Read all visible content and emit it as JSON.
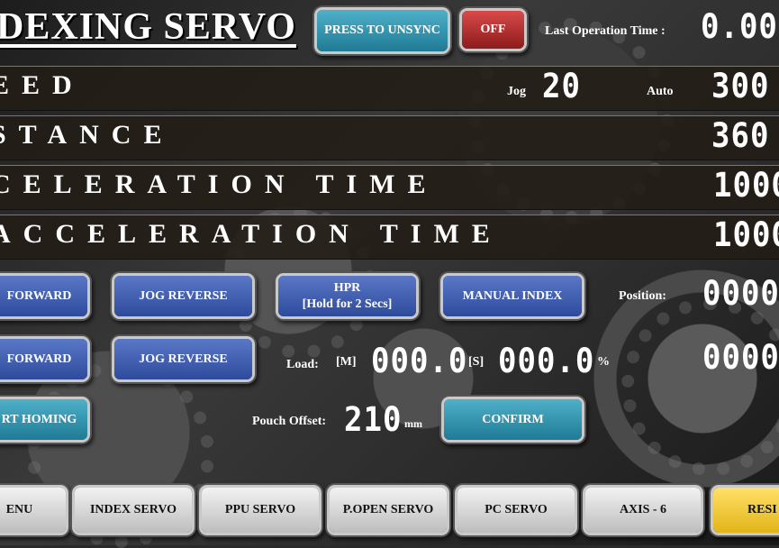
{
  "header": {
    "title": "DEXING SERVO",
    "sync_button": "PRESS TO UNSYNC",
    "off_button": "OFF",
    "last_op_label": "Last Operation Time :",
    "last_op_value": "0.00"
  },
  "rows": {
    "speed": {
      "label": "EED",
      "jog_label": "Jog",
      "jog_value": "20",
      "auto_label": "Auto",
      "auto_value": "300"
    },
    "distance": {
      "label": "STANCE",
      "value": "360"
    },
    "acceleration": {
      "label": "CELERATION TIME",
      "value": "1000"
    },
    "deceleration": {
      "label": "ACCELERATION TIME",
      "value": "1000"
    }
  },
  "controls": {
    "row1": {
      "forward": "FORWARD",
      "jog_reverse": "JOG REVERSE",
      "hpr": "HPR\n[Hold for 2 Secs]",
      "manual_index": "MANUAL INDEX",
      "position_label": "Position:",
      "position_value": "0000"
    },
    "row2": {
      "forward": "FORWARD",
      "jog_reverse": "JOG REVERSE",
      "load_label": "Load:",
      "m_label": "[M]",
      "m_value": "000.0",
      "s_label": "[S]",
      "s_value": "000.0",
      "percent": "%",
      "value": "0000"
    },
    "row3": {
      "homing": "RT HOMING",
      "pouch_label": "Pouch Offset:",
      "pouch_value": "210",
      "pouch_unit": "mm",
      "confirm": "CONFIRM"
    }
  },
  "nav": [
    "ENU",
    "INDEX SERVO",
    "PPU SERVO",
    "P.OPEN SERVO",
    "PC SERVO",
    "AXIS - 6",
    "RESI"
  ],
  "colors": {
    "blue": "#3a5bb0",
    "teal": "#2a90ad",
    "red": "#b82727",
    "yellow": "#f0c53a"
  }
}
